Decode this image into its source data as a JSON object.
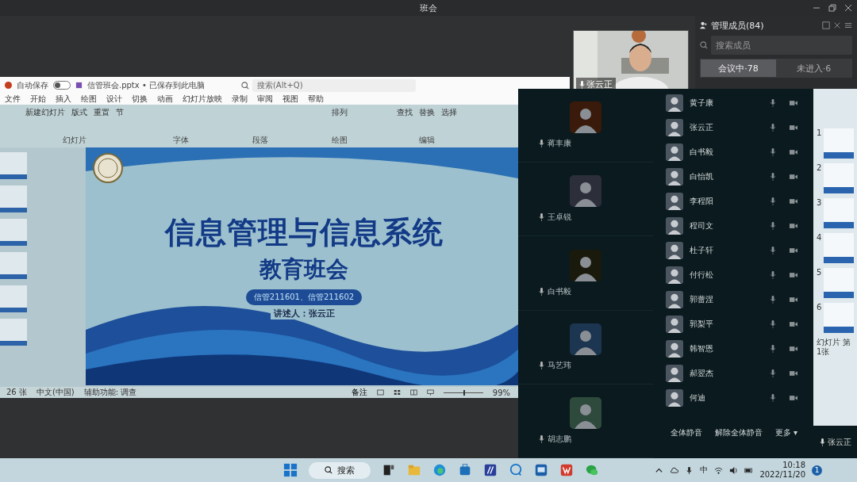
{
  "window": {
    "title": "班会"
  },
  "presenter_video": {
    "name": "张云正"
  },
  "members_panel": {
    "title": "管理成员(84)",
    "search": {
      "placeholder": "搜索成员"
    },
    "tabs": [
      {
        "label": "会议中·78",
        "selected": true
      },
      {
        "label": "未进入·6",
        "selected": false
      }
    ]
  },
  "ppt": {
    "autosave_label": "自动保存",
    "autosave_on": false,
    "file_title": "信管班会.pptx • 已保存到此电脑",
    "search": {
      "placeholder": "搜索(Alt+Q)"
    },
    "menu": [
      "文件",
      "开始",
      "插入",
      "绘图",
      "设计",
      "切换",
      "动画",
      "幻灯片放映",
      "录制",
      "审阅",
      "视图",
      "帮助"
    ],
    "ribbon_groups": [
      {
        "label": "幻灯片",
        "buttons": [
          "新建幻灯片",
          "版式",
          "重置",
          "节"
        ]
      },
      {
        "label": "字体"
      },
      {
        "label": "段落"
      },
      {
        "label": "绘图",
        "buttons": [
          "排列"
        ]
      },
      {
        "label": "编辑",
        "buttons": [
          "查找",
          "替换",
          "选择"
        ]
      }
    ],
    "slide": {
      "title": "信息管理与信息系统",
      "subtitle": "教育班会",
      "classes": "信管211601、信管211602",
      "presenter": "讲述人：张云正"
    },
    "status": {
      "slide_count": "26 张",
      "language": "中文(中国)",
      "accessibility": "辅助功能: 调查",
      "notes": "备注",
      "zoom": "99%"
    },
    "zoom_slider": {
      "level": 0.5
    }
  },
  "gallery_tiles": [
    {
      "name": "蒋丰康"
    },
    {
      "name": "王卓锐"
    },
    {
      "name": "白书毅"
    },
    {
      "name": "马艺玮"
    },
    {
      "name": "胡志鹏"
    }
  ],
  "member_list": [
    {
      "name": "黄子康"
    },
    {
      "name": "张云正"
    },
    {
      "name": "白书毅"
    },
    {
      "name": "白怡凯"
    },
    {
      "name": "李程阳"
    },
    {
      "name": "程司文"
    },
    {
      "name": "杜子轩"
    },
    {
      "name": "付行松"
    },
    {
      "name": "郭蕾涅"
    },
    {
      "name": "郭梨平"
    },
    {
      "name": "韩智恩"
    },
    {
      "name": "郝翌杰"
    },
    {
      "name": "何迪"
    }
  ],
  "member_actions": [
    "全体静音",
    "解除全体静音",
    "更多 ▾"
  ],
  "self": {
    "name": "张云正"
  },
  "second_window": {
    "thumbnails": [
      "1",
      "2",
      "3",
      "4",
      "5",
      "6"
    ],
    "status": "幻灯片 第1张"
  },
  "taskbar": {
    "search": "搜索",
    "ime": "中",
    "time": "10:18",
    "date": "2022/11/20",
    "notifications": "1"
  }
}
